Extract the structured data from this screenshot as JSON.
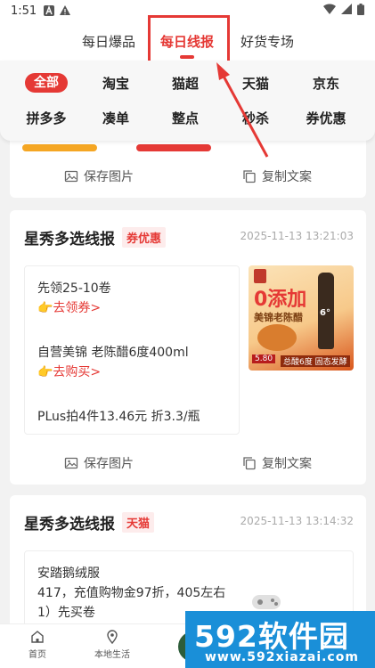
{
  "status_bar": {
    "time": "1:51"
  },
  "top_tabs": [
    {
      "label": "每日爆品"
    },
    {
      "label": "每日线报"
    },
    {
      "label": "好货专场"
    }
  ],
  "categories": [
    "全部",
    "淘宝",
    "猫超",
    "天猫",
    "京东",
    "拼多多",
    "凑单",
    "整点",
    "秒杀",
    "券优惠"
  ],
  "actions": {
    "save_image": "保存图片",
    "copy_text": "复制文案"
  },
  "posts": [
    {
      "title": "星秀多选线报",
      "tag": "券优惠",
      "time": "2025-11-13 13:21:03",
      "line1": "先领25-10卷",
      "link1": "👉去领券>",
      "line2": "自营美锦 老陈醋6度400ml",
      "link2": "👉去购买>",
      "line3": "PLus拍4件13.46元 折3.3/瓶",
      "image": {
        "headline": "0添加",
        "brand": "美锦老陈醋",
        "badge": "6°",
        "price": "5.80",
        "footer": "总酸6度 固态发酵"
      }
    },
    {
      "title": "星秀多选线报",
      "tag": "天猫",
      "time": "2025-11-13 13:14:32",
      "line1": "安踏鹅绒服",
      "line2": "417，充值购物金97折，405左右",
      "line3": "1）先买卷"
    }
  ],
  "bottom_nav": [
    {
      "label": "首页"
    },
    {
      "label": "本地生活"
    }
  ],
  "watermark": {
    "big": "592软件园",
    "url": "www.592xiazai.com"
  },
  "colors": {
    "accent": "#e53935",
    "tag_bg": "#fdecec",
    "watermark": "#1a8fd8"
  }
}
